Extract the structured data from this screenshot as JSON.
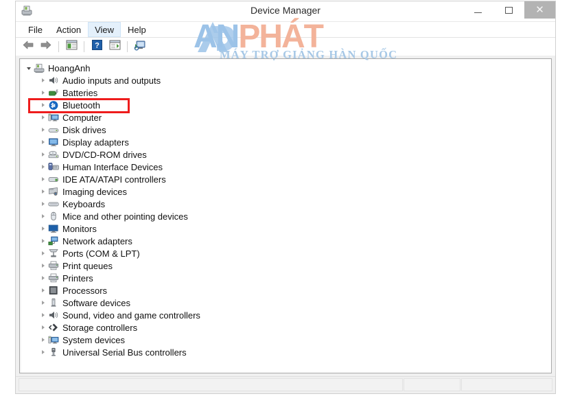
{
  "window": {
    "title": "Device Manager",
    "icon": "device-manager-icon",
    "controls": {
      "minimize": "–",
      "maximize": "□",
      "close": "✕"
    }
  },
  "menubar": {
    "items": [
      {
        "label": "File",
        "name": "menu-file",
        "active": false
      },
      {
        "label": "Action",
        "name": "menu-action",
        "active": false
      },
      {
        "label": "View",
        "name": "menu-view",
        "active": true
      },
      {
        "label": "Help",
        "name": "menu-help",
        "active": false
      }
    ]
  },
  "toolbar": {
    "buttons": [
      {
        "name": "back-arrow-icon",
        "tooltip": "Back"
      },
      {
        "name": "forward-arrow-icon",
        "tooltip": "Forward"
      },
      {
        "name": "show-hide-console-tree-icon",
        "tooltip": "Show/Hide Console Tree"
      },
      {
        "name": "help-question-icon",
        "tooltip": "Help"
      },
      {
        "name": "properties-icon",
        "tooltip": "Properties"
      },
      {
        "name": "scan-for-hardware-changes-icon",
        "tooltip": "Scan for hardware changes"
      }
    ]
  },
  "tree": {
    "root": {
      "label": "HoangAnh",
      "icon": "computer-root-icon",
      "expanded": true
    },
    "nodes": [
      {
        "label": "Audio inputs and outputs",
        "icon": "speaker-icon"
      },
      {
        "label": "Batteries",
        "icon": "battery-icon"
      },
      {
        "label": "Bluetooth",
        "icon": "bluetooth-icon",
        "highlighted": true
      },
      {
        "label": "Computer",
        "icon": "computer-icon"
      },
      {
        "label": "Disk drives",
        "icon": "disk-drive-icon"
      },
      {
        "label": "Display adapters",
        "icon": "display-adapter-icon"
      },
      {
        "label": "DVD/CD-ROM drives",
        "icon": "dvd-drive-icon"
      },
      {
        "label": "Human Interface Devices",
        "icon": "hid-icon"
      },
      {
        "label": "IDE ATA/ATAPI controllers",
        "icon": "ide-controller-icon"
      },
      {
        "label": "Imaging devices",
        "icon": "camera-icon"
      },
      {
        "label": "Keyboards",
        "icon": "keyboard-icon"
      },
      {
        "label": "Mice and other pointing devices",
        "icon": "mouse-icon"
      },
      {
        "label": "Monitors",
        "icon": "monitor-icon"
      },
      {
        "label": "Network adapters",
        "icon": "network-adapter-icon"
      },
      {
        "label": "Ports (COM & LPT)",
        "icon": "port-icon"
      },
      {
        "label": "Print queues",
        "icon": "print-queue-icon"
      },
      {
        "label": "Printers",
        "icon": "printer-icon"
      },
      {
        "label": "Processors",
        "icon": "processor-icon"
      },
      {
        "label": "Software devices",
        "icon": "software-device-icon"
      },
      {
        "label": "Sound, video and game controllers",
        "icon": "sound-controller-icon"
      },
      {
        "label": "Storage controllers",
        "icon": "storage-controller-icon"
      },
      {
        "label": "System devices",
        "icon": "system-device-icon"
      },
      {
        "label": "Universal Serial Bus controllers",
        "icon": "usb-controller-icon"
      }
    ]
  },
  "highlight": {
    "color": "#ee1c1c",
    "target": "Bluetooth"
  },
  "statusbar": {
    "pane1": "",
    "pane2": "",
    "pane3": ""
  },
  "watermark": {
    "brand_a": "A",
    "brand_an": "AN",
    "brand_phat": "PHÁT",
    "tagline": "MÁY TRỢ GIẢNG HÀN QUỐC",
    "color_blue": "#9cc3e8",
    "color_orange": "#f3b39a"
  }
}
